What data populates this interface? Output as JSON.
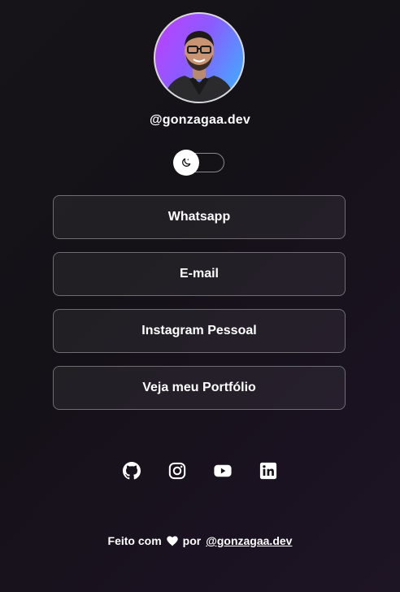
{
  "profile": {
    "handle": "@gonzagaa.dev"
  },
  "theme_toggle": {
    "icon": "moon-icon",
    "state": "dark"
  },
  "links": [
    {
      "label": "Whatsapp"
    },
    {
      "label": "E-mail"
    },
    {
      "label": "Instagram Pessoal"
    },
    {
      "label": "Veja meu Portfólio"
    }
  ],
  "socials": [
    {
      "icon": "github-icon"
    },
    {
      "icon": "instagram-icon"
    },
    {
      "icon": "youtube-icon"
    },
    {
      "icon": "linkedin-icon"
    }
  ],
  "footer": {
    "prefix": "Feito com",
    "middle": "por",
    "author_link": "@gonzagaa.dev"
  },
  "colors": {
    "background": "#161419",
    "button_border": "#6f6c74",
    "text": "#ffffff",
    "avatar_gradient_start": "#c23cff",
    "avatar_gradient_end": "#36b6ff"
  }
}
